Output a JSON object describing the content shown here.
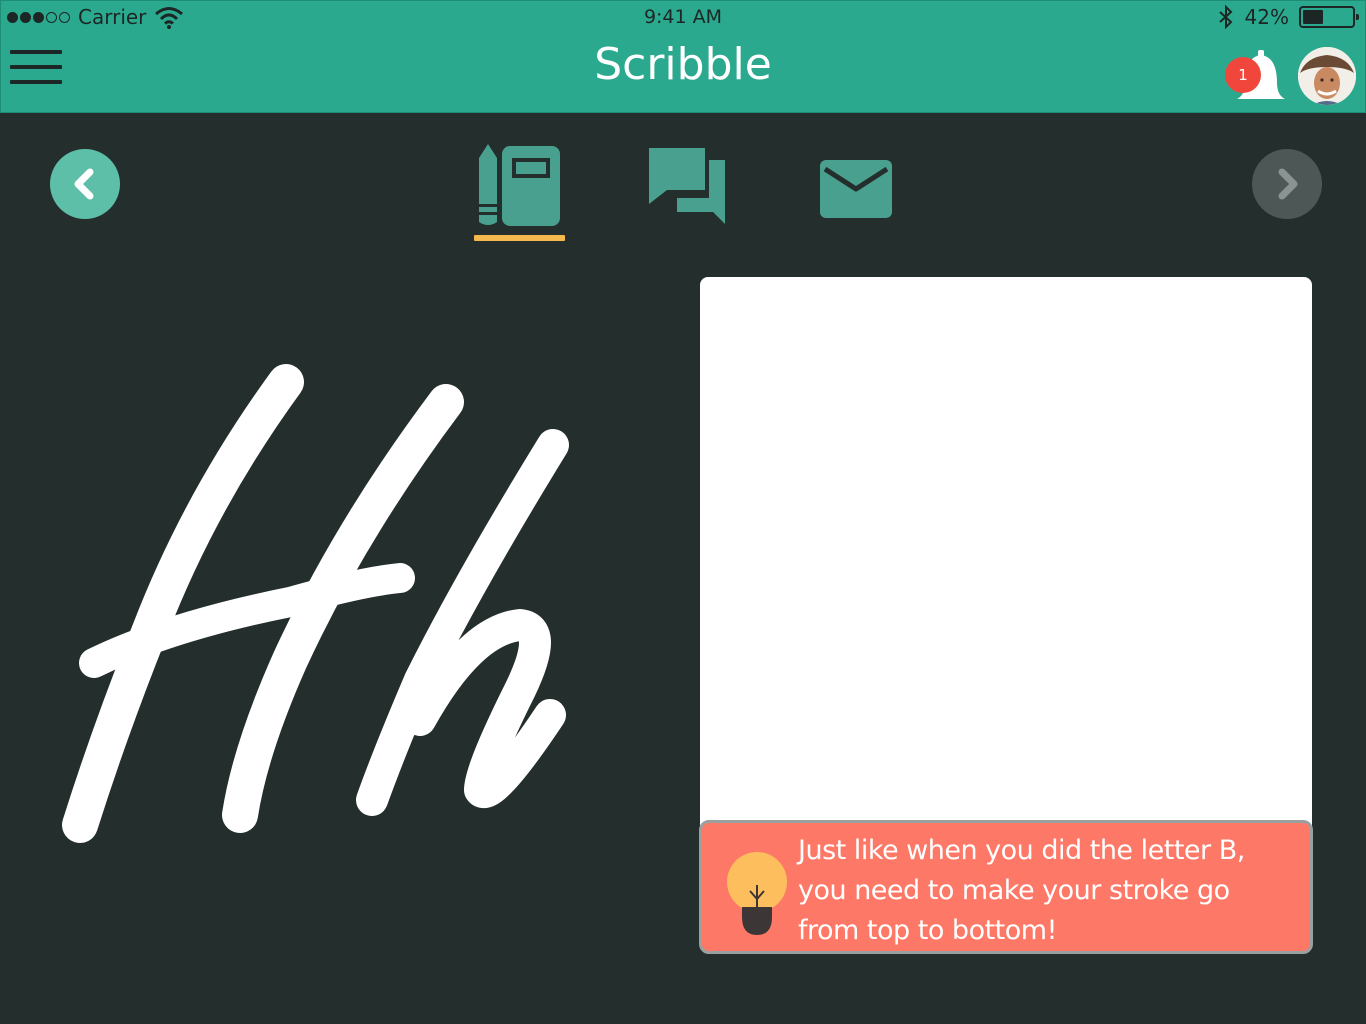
{
  "status_bar": {
    "carrier": "Carrier",
    "time": "9:41 AM",
    "battery_text": "42%",
    "battery_level": 0.42
  },
  "header": {
    "title": "Scribble",
    "notification_count": "1"
  },
  "nav": {
    "tabs": [
      {
        "icon": "notebook-pencil-icon",
        "active": true
      },
      {
        "icon": "chat-bubbles-icon",
        "active": false
      },
      {
        "icon": "mail-icon",
        "active": false
      }
    ]
  },
  "lesson": {
    "letters": "Hh"
  },
  "hint": {
    "text": "Just like when you did the letter B, you need to make your stroke go from top to bottom!"
  },
  "colors": {
    "header": "#2ba98f",
    "background": "#232e2d",
    "accent": "#5ebfa9",
    "icon": "#4aa08e",
    "underline": "#f4b84f",
    "hint": "#fe7867",
    "badge": "#f0463c"
  }
}
